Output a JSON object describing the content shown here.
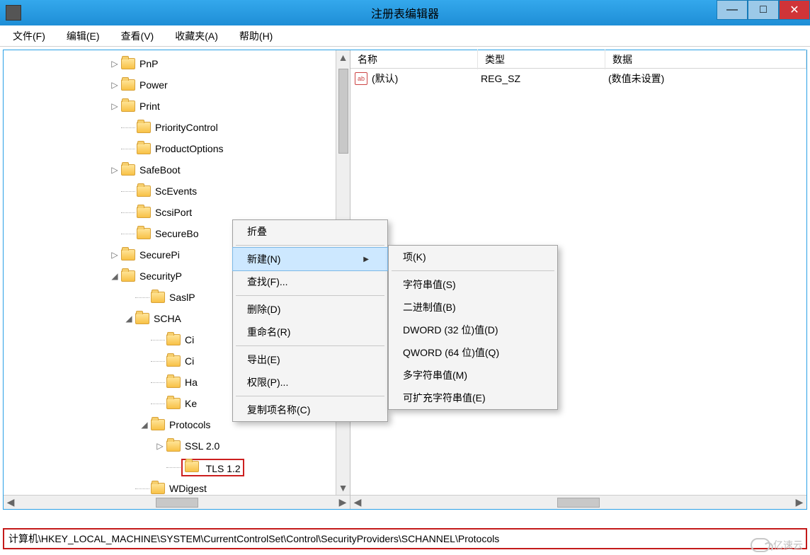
{
  "window": {
    "title": "注册表编辑器"
  },
  "menubar": [
    "文件(F)",
    "编辑(E)",
    "查看(V)",
    "收藏夹(A)",
    "帮助(H)"
  ],
  "tree": [
    {
      "depth": 0,
      "expander": "▷",
      "label": "PnP"
    },
    {
      "depth": 0,
      "expander": "▷",
      "label": "Power"
    },
    {
      "depth": 0,
      "expander": "▷",
      "label": "Print"
    },
    {
      "depth": 0,
      "expander": "",
      "label": "PriorityControl"
    },
    {
      "depth": 0,
      "expander": "",
      "label": "ProductOptions"
    },
    {
      "depth": 0,
      "expander": "▷",
      "label": "SafeBoot"
    },
    {
      "depth": 0,
      "expander": "",
      "label": "ScEvents"
    },
    {
      "depth": 0,
      "expander": "",
      "label": "ScsiPort"
    },
    {
      "depth": 0,
      "expander": "",
      "label": "SecureBo"
    },
    {
      "depth": 0,
      "expander": "▷",
      "label": "SecurePi"
    },
    {
      "depth": 0,
      "expander": "◢",
      "label": "SecurityP"
    },
    {
      "depth": 1,
      "expander": "",
      "label": "SaslP"
    },
    {
      "depth": 1,
      "expander": "◢",
      "label": "SCHA"
    },
    {
      "depth": 2,
      "expander": "",
      "label": "Ci"
    },
    {
      "depth": 2,
      "expander": "",
      "label": "Ci"
    },
    {
      "depth": 2,
      "expander": "",
      "label": "Ha"
    },
    {
      "depth": 2,
      "expander": "",
      "label": "Ke"
    },
    {
      "depth": 2,
      "expander": "◢",
      "label": "Protocols"
    },
    {
      "depth": 3,
      "expander": "▷",
      "label": "SSL 2.0"
    },
    {
      "depth": 3,
      "expander": "",
      "label": "TLS 1.2",
      "selected": true
    },
    {
      "depth": 1,
      "expander": "",
      "label": "WDigest"
    }
  ],
  "values": {
    "columns": {
      "name": "名称",
      "type": "类型",
      "data": "数据"
    },
    "rows": [
      {
        "icon": "ab",
        "name": "(默认)",
        "type": "REG_SZ",
        "data": "(数值未设置)"
      }
    ]
  },
  "context_menu_1": {
    "collapse": "折叠",
    "new": "新建(N)",
    "find": "查找(F)...",
    "delete": "删除(D)",
    "rename": "重命名(R)",
    "export": "导出(E)",
    "permissions": "权限(P)...",
    "copy_key_name": "复制项名称(C)"
  },
  "context_menu_2": {
    "key": "项(K)",
    "string": "字符串值(S)",
    "binary": "二进制值(B)",
    "dword": "DWORD (32 位)值(D)",
    "qword": "QWORD (64 位)值(Q)",
    "multi_string": "多字符串值(M)",
    "expandable_string": "可扩充字符串值(E)"
  },
  "statusbar": "计算机\\HKEY_LOCAL_MACHINE\\SYSTEM\\CurrentControlSet\\Control\\SecurityProviders\\SCHANNEL\\Protocols",
  "watermark": "亿速云"
}
